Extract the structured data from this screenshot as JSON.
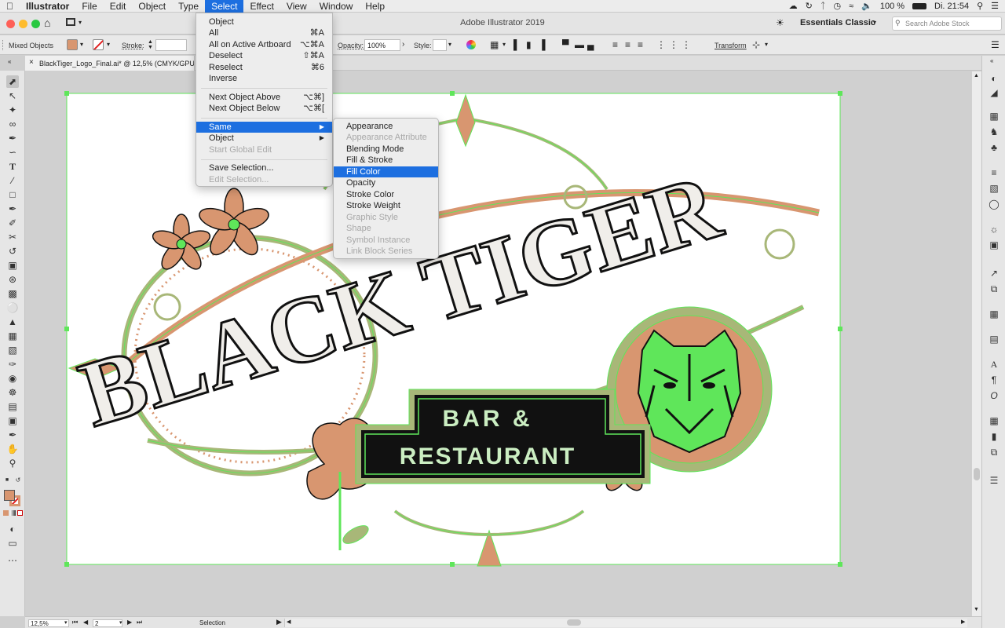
{
  "menubar": {
    "app_name": "Illustrator",
    "items": [
      "File",
      "Edit",
      "Object",
      "Type",
      "Select",
      "Effect",
      "View",
      "Window",
      "Help"
    ],
    "active_index": 4,
    "battery": "100 %",
    "clock": "Di. 21:54"
  },
  "app_header": {
    "title": "Adobe Illustrator 2019",
    "workspace": "Essentials Classic",
    "stock_search_placeholder": "Search Adobe Stock"
  },
  "control_bar": {
    "selection_label": "Mixed Objects",
    "stroke_label": "Stroke:",
    "opacity_label": "Opacity:",
    "opacity_value": "100%",
    "style_label": "Style:",
    "transform_label": "Transform"
  },
  "document_tab": {
    "title": "BlackTiger_Logo_Final.ai* @ 12,5% (CMYK/GPU Preview)"
  },
  "artwork": {
    "title_line1": "BLACK TIGER",
    "title_line2": "BAR &",
    "title_line3": "RESTAURANT"
  },
  "colors": {
    "selection_green": "#5fe65a",
    "ornament_copper": "#d89670",
    "ornament_olive": "#a8b778",
    "letter_fill": "#f0eeea",
    "badge_black": "#111111",
    "accent_blue": "#1d6fe0"
  },
  "select_menu": {
    "items": [
      {
        "label": "Object",
        "shortcut": "",
        "disabled": false,
        "arrow": false
      },
      {
        "label": "All",
        "shortcut": "⌘A",
        "disabled": false,
        "arrow": false
      },
      {
        "label": "All on Active Artboard",
        "shortcut": "⌥⌘A",
        "disabled": false,
        "arrow": false
      },
      {
        "label": "Deselect",
        "shortcut": "⇧⌘A",
        "disabled": false,
        "arrow": false
      },
      {
        "label": "Reselect",
        "shortcut": "⌘6",
        "disabled": false,
        "arrow": false
      },
      {
        "label": "Inverse",
        "shortcut": "",
        "disabled": false,
        "arrow": false
      },
      {
        "label": "Next Object Above",
        "shortcut": "⌥⌘]",
        "disabled": false,
        "arrow": false
      },
      {
        "label": "Next Object Below",
        "shortcut": "⌥⌘[",
        "disabled": false,
        "arrow": false
      },
      {
        "label": "Same",
        "shortcut": "▶",
        "disabled": false,
        "arrow": true
      },
      {
        "label": "Object",
        "shortcut": "▶",
        "disabled": false,
        "arrow": true
      },
      {
        "label": "Start Global Edit",
        "shortcut": "",
        "disabled": true,
        "arrow": false
      },
      {
        "label": "Save Selection...",
        "shortcut": "",
        "disabled": false,
        "arrow": false
      },
      {
        "label": "Edit Selection...",
        "shortcut": "",
        "disabled": true,
        "arrow": false
      }
    ]
  },
  "same_submenu": {
    "items": [
      {
        "label": "Appearance",
        "disabled": false
      },
      {
        "label": "Appearance Attribute",
        "disabled": true
      },
      {
        "label": "Blending Mode",
        "disabled": false
      },
      {
        "label": "Fill & Stroke",
        "disabled": false
      },
      {
        "label": "Fill Color",
        "disabled": false
      },
      {
        "label": "Opacity",
        "disabled": false
      },
      {
        "label": "Stroke Color",
        "disabled": false
      },
      {
        "label": "Stroke Weight",
        "disabled": false
      },
      {
        "label": "Graphic Style",
        "disabled": true
      },
      {
        "label": "Shape",
        "disabled": true
      },
      {
        "label": "Symbol Instance",
        "disabled": true
      },
      {
        "label": "Link Block Series",
        "disabled": true
      }
    ],
    "highlighted_index": 4
  },
  "status_bar": {
    "zoom": "12,5%",
    "artboard_number": "2",
    "status_text": "Selection"
  }
}
